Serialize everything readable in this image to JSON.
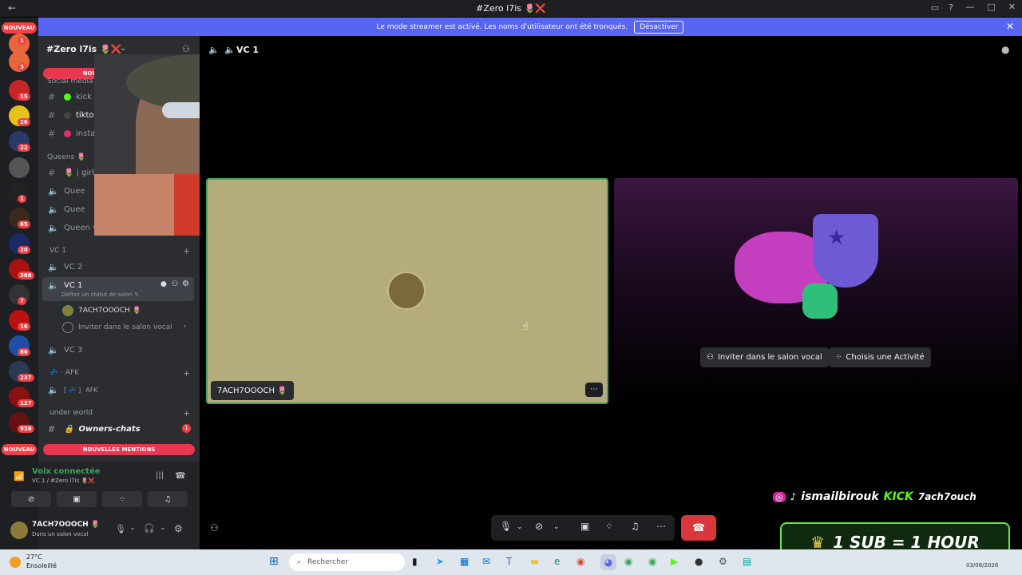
{
  "titlebar": {
    "title": "#Zero l7is 🌷❌",
    "back": "←",
    "min": "—",
    "max": "□",
    "close": "✕"
  },
  "banner": {
    "text": "Le mode streamer est activé. Les noms d'utilisateur ont été tronqués.",
    "button": "Désactiver"
  },
  "guilds": {
    "nouveau_top": "NOUVEAU",
    "nouveau_bottom": "NOUVEAU",
    "badges": [
      "1",
      "3",
      "15",
      "26",
      "22",
      "1",
      "65",
      "20",
      "388",
      "7",
      "16",
      "86",
      "237",
      "127",
      "938"
    ]
  },
  "server": {
    "name": "#Zero l7is 🌷❌"
  },
  "sidebar": {
    "mentions_top": "NOUVELLES MENTIONS",
    "mentions_bottom": "NOUVELLES MENTIONS",
    "cat_social": "Social media",
    "kick": "kick",
    "tiktok": "tiktok",
    "instagram": "instagram",
    "cat_queens": "Queens 🌷",
    "queens_1": "🌷 | girl",
    "queens_2": "Quee",
    "queens_3": "Quee",
    "queens_4": "Queen v",
    "cat_vc1": "VC 1",
    "vc2": "VC 2",
    "vc1": "VC 1",
    "vc1_status": "Définir un statut de salon ✎",
    "member": "7ACH7OOOCH 🌷",
    "invite": "Inviter dans le salon vocal",
    "vc3": "VC 3",
    "cat_afk": "AFK",
    "afk": "AFK",
    "cat_underworld": "under world",
    "owners": "Owners-chats",
    "owners_badge": "1"
  },
  "voice_panel": {
    "status": "Voix connectée",
    "channel": "VC 1 / #Zero l7is 🌷❌"
  },
  "user": {
    "name": "7ACH7OOOCH 🌷",
    "status": "Dans un salon vocal"
  },
  "main": {
    "header": "VC 1",
    "tile_name": "7ACH7OOOCH 🌷",
    "invite_btn": "Inviter dans le salon vocal",
    "activity_btn": "Choisis une Activité"
  },
  "overlay": {
    "social": "ismailbirouk",
    "kick": "KICK",
    "kick_user": "7ach7ouch",
    "sub": "1 SUB = 1 HOUR"
  },
  "taskbar": {
    "temp": "27°C",
    "weather": "Ensoleillé",
    "search_placeholder": "Rechercher",
    "date": "03/08/2026"
  },
  "colors": {
    "blurple": "#5865f2",
    "green": "#3ba55c",
    "red": "#da373c"
  }
}
